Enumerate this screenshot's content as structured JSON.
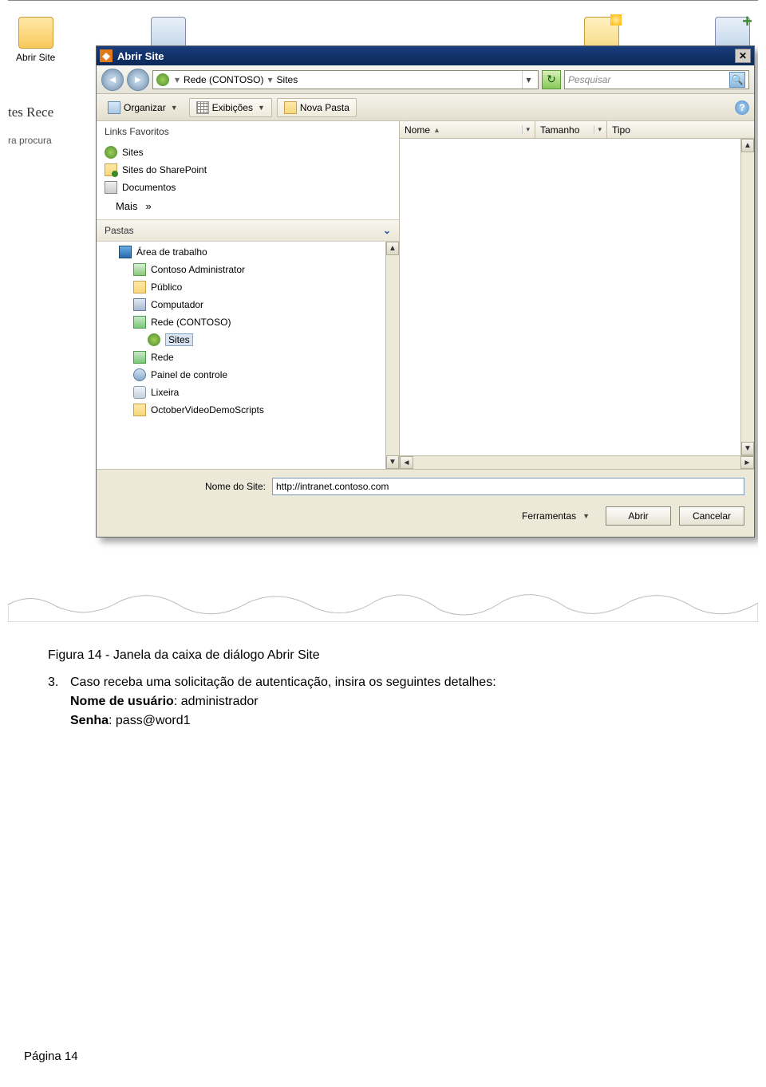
{
  "background": {
    "ribbon_item_label": "Abrir Site",
    "left_text_1": "tes Rece",
    "left_text_2": "ra procura"
  },
  "dialog": {
    "title": "Abrir Site",
    "title_icon_char": "✖",
    "breadcrumb": {
      "part1": "Rede (CONTOSO)",
      "part2": "Sites"
    },
    "search_placeholder": "Pesquisar",
    "toolbar": {
      "organize": "Organizar",
      "views": "Exibições",
      "new_folder": "Nova Pasta"
    },
    "favorites_header": "Links Favoritos",
    "favorites": [
      {
        "icon": "ico-globe",
        "label": "Sites"
      },
      {
        "icon": "ico-sp",
        "label": "Sites do SharePoint"
      },
      {
        "icon": "ico-docs",
        "label": "Documentos"
      }
    ],
    "favorites_more": "Mais",
    "favorites_more_arrow": "»",
    "folders_header": "Pastas",
    "tree": [
      {
        "indent": 1,
        "icon": "ico-desktop",
        "label": "Área de trabalho"
      },
      {
        "indent": 2,
        "icon": "ico-user",
        "label": "Contoso Administrator"
      },
      {
        "indent": 2,
        "icon": "ico-folder",
        "label": "Público"
      },
      {
        "indent": 2,
        "icon": "ico-comp",
        "label": "Computador"
      },
      {
        "indent": 2,
        "icon": "ico-net",
        "label": "Rede (CONTOSO)"
      },
      {
        "indent": 3,
        "icon": "ico-globe",
        "label": "Sites",
        "selected": true
      },
      {
        "indent": 2,
        "icon": "ico-net",
        "label": "Rede"
      },
      {
        "indent": 2,
        "icon": "ico-ctrl",
        "label": "Painel de controle"
      },
      {
        "indent": 2,
        "icon": "ico-trash",
        "label": "Lixeira"
      },
      {
        "indent": 2,
        "icon": "ico-folder",
        "label": "OctoberVideoDemoScripts"
      }
    ],
    "columns": {
      "name": "Nome",
      "size": "Tamanho",
      "type": "Tipo"
    },
    "site_name_label": "Nome do Site:",
    "site_name_value": "http://intranet.contoso.com",
    "tools": "Ferramentas",
    "open": "Abrir",
    "cancel": "Cancelar"
  },
  "doc": {
    "caption": "Figura 14 - Janela da caixa de diálogo Abrir Site",
    "step_num": "3.",
    "step_text": "Caso receba uma solicitação de autenticação, insira os seguintes detalhes:",
    "user_label": "Nome de usuário",
    "user_value": ": administrador",
    "pass_label": "Senha",
    "pass_value": ": pass@word1",
    "page_footer": "Página 14"
  }
}
